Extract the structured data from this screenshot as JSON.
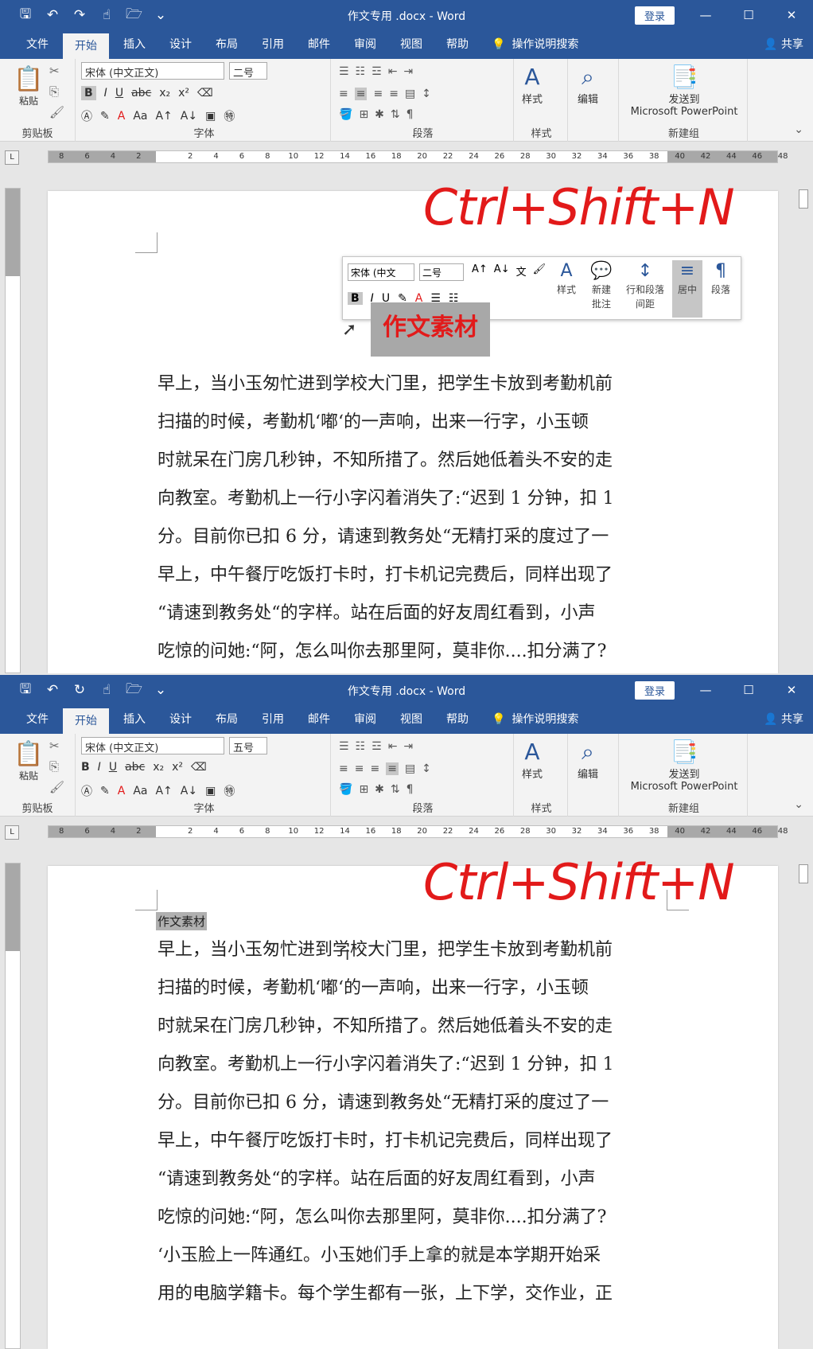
{
  "app": {
    "title": "作文专用 .docx  -  Word",
    "login": "登录",
    "share": "共享",
    "search": "操作说明搜索"
  },
  "tabs": [
    "文件",
    "开始",
    "插入",
    "设计",
    "布局",
    "引用",
    "邮件",
    "审阅",
    "视图",
    "帮助"
  ],
  "ribbon": {
    "paste": "粘贴",
    "clipboard": "剪贴板",
    "font_group": "字体",
    "font_name": "宋体 (中文正文)",
    "paragraph_group": "段落",
    "styles": "样式",
    "styles_group": "样式",
    "edit": "编辑",
    "send_to_1": "发送到",
    "send_to_2": "Microsoft PowerPoint",
    "new_group": "新建组"
  },
  "ruler_numbers": [
    "8",
    "6",
    "4",
    "2",
    "",
    "2",
    "4",
    "6",
    "8",
    "10",
    "12",
    "14",
    "16",
    "18",
    "20",
    "22",
    "24",
    "26",
    "28",
    "30",
    "32",
    "34",
    "36",
    "38",
    "40",
    "42",
    "44",
    "46",
    "48"
  ],
  "shortcut": "Ctrl+Shift+N",
  "shot1": {
    "font_size": "二号",
    "heading": "作文素材",
    "mini_toolbar": {
      "font": "宋体 (中文",
      "size": "二号",
      "styles": "样式",
      "new_comment_1": "新建",
      "new_comment_2": "批注",
      "spacing_1": "行和段落",
      "spacing_2": "间距",
      "center": "居中",
      "paragraph": "段落"
    }
  },
  "shot2": {
    "font_size": "五号",
    "heading": "作文素材"
  },
  "body_lines": [
    "早上，当小玉匆忙进到学校大门里，把学生卡放到考勤机前",
    "扫描的时候，考勤机‘嘟‘的一声响，出来一行字，小玉顿",
    "时就呆在门房几秒钟，不知所措了。然后她低着头不安的走",
    "向教室。考勤机上一行小字闪着消失了:“迟到 1 分钟，扣 1",
    "分。目前你已扣 6 分，请速到教务处“无精打采的度过了一",
    "早上，中午餐厅吃饭打卡时，打卡机记完费后，同样出现了",
    "“请速到教务处“的字样。站在后面的好友周红看到，小声",
    "吃惊的问她:“阿，怎么叫你去那里阿，莫非你....扣分满了?",
    "‘小玉脸上一阵通红。小玉她们手上拿的就是本学期开始采",
    "用的电脑学籍卡。每个学生都有一张，上下学，交作业，正"
  ]
}
